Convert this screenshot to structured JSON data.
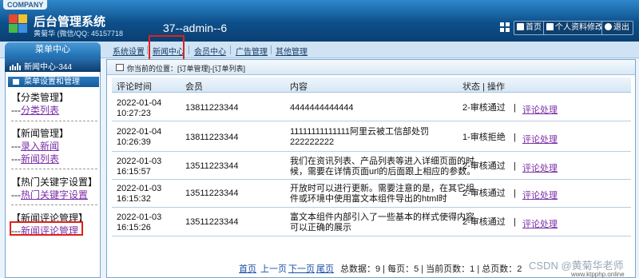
{
  "header": {
    "company": "COMPANY",
    "system_title": "后台管理系统",
    "system_sub": "黄菊华 (微信/QQ: 45157718",
    "user_title": "37--admin--6",
    "buttons": [
      "首页",
      "个人资料修改",
      "退出"
    ]
  },
  "nav": {
    "menu_center": "菜单中心",
    "items": [
      "系统设置",
      "新闻中心",
      "会员中心",
      "广告管理",
      "其他管理"
    ]
  },
  "sidebar": {
    "header": "新闻中心-344",
    "section": "菜单设置和管理",
    "groups": [
      {
        "title": "【分类管理】",
        "links": [
          {
            "prefix": "---",
            "label": "分类列表"
          }
        ]
      },
      {
        "title": "【新闻管理】",
        "links": [
          {
            "prefix": "---",
            "label": "录入新闻"
          },
          {
            "prefix": "---",
            "label": "新闻列表"
          }
        ]
      },
      {
        "title": "【热门关键字设置】",
        "links": [
          {
            "prefix": "---",
            "label": "热门关键字设置"
          }
        ]
      },
      {
        "title": "【新闻评论管理】",
        "links": [
          {
            "prefix": "---",
            "label": "新闻评论管理"
          }
        ]
      }
    ]
  },
  "main": {
    "breadcrumb": "你当前的位置：[订单管理]-[订单列表]",
    "columns": [
      "评论时间",
      "会员",
      "内容",
      "状态 | 操作"
    ],
    "rows": [
      {
        "date": "2022-01-04",
        "time": "10:27:23",
        "member": "13811223344",
        "content": [
          "4444444444444"
        ],
        "status": "2-审核通过",
        "action": "评论处理"
      },
      {
        "date": "2022-01-04",
        "time": "10:26:39",
        "member": "13811223344",
        "content": [
          "11111111111111阿里云被工信部处罚",
          "222222222"
        ],
        "status": "1-审核拒绝",
        "action": "评论处理"
      },
      {
        "date": "2022-01-03",
        "time": "16:15:57",
        "member": "13511223344",
        "content": [
          "我们在资讯列表、产品列表等进入详细页面的时",
          "候，需要在详情页面url的后面跟上相应的参数。"
        ],
        "status": "2-审核通过",
        "action": "评论处理"
      },
      {
        "date": "2022-01-03",
        "time": "16:15:32",
        "member": "13511223344",
        "content": [
          "开放时可以进行更新。需要注意的是，在其它组",
          "件或环境中使用富文本组件导出的html时"
        ],
        "status": "2-审核通过",
        "action": "评论处理"
      },
      {
        "date": "2022-01-03",
        "time": "16:15:26",
        "member": "13511223344",
        "content": [
          "富文本组件内部引入了一些基本的样式使得内容",
          "可以正确的展示"
        ],
        "status": "2-审核通过",
        "action": "评论处理"
      }
    ],
    "pager": {
      "first": "首页",
      "prev": "上一页",
      "next": "下一页",
      "last": "尾页",
      "info": "总数据：9 | 每页：5 | 当前页数：1 | 总页数：2"
    }
  },
  "watermark": "CSDN @黄菊华老师",
  "watermark_small": "www.ktpphp.online"
}
